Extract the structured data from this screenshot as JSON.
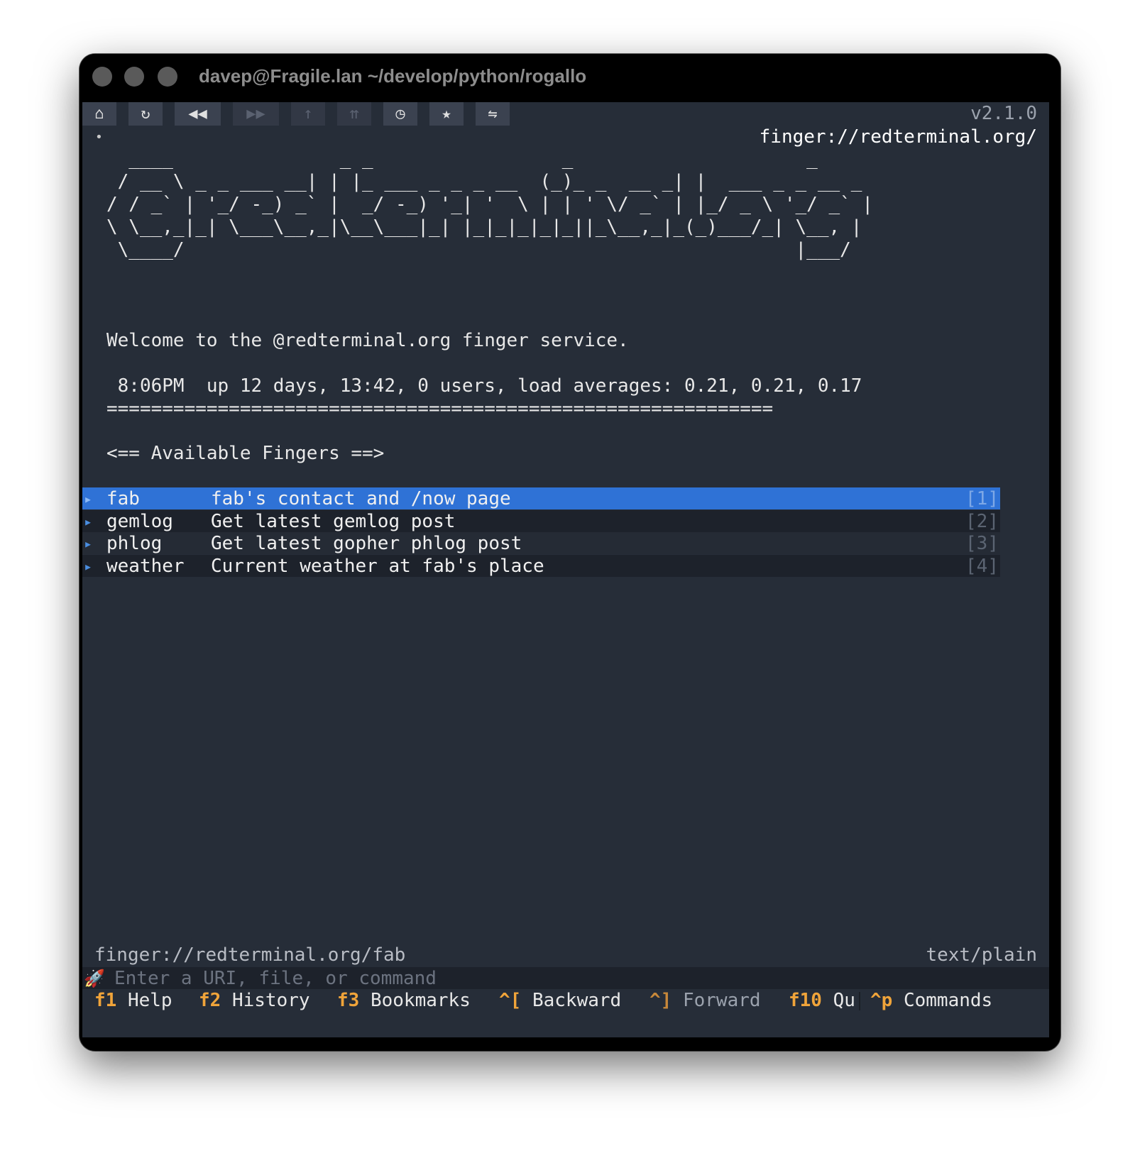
{
  "window": {
    "title": "davep@Fragile.lan ~/develop/python/rogallo"
  },
  "toolbar": {
    "buttons": [
      {
        "icon": "home-icon",
        "glyph": "⌂",
        "enabled": true
      },
      {
        "icon": "reload-icon",
        "glyph": "↻",
        "enabled": true
      },
      {
        "icon": "back-icon",
        "glyph": "◀◀",
        "enabled": true
      },
      {
        "icon": "forward-icon",
        "glyph": "▶▶",
        "enabled": false
      },
      {
        "icon": "up-icon",
        "glyph": "↑",
        "enabled": false
      },
      {
        "icon": "root-icon",
        "glyph": "⇈",
        "enabled": false
      },
      {
        "icon": "history-icon",
        "glyph": "◷",
        "enabled": true
      },
      {
        "icon": "bookmark-icon",
        "glyph": "★",
        "enabled": true
      },
      {
        "icon": "swap-icon",
        "glyph": "⇋",
        "enabled": true
      }
    ],
    "version": "v2.1.0"
  },
  "location": {
    "dot": "•",
    "url": "finger://redterminal.org/"
  },
  "content": {
    "ascii_banner": "  ____               _ _                 _                     _\n / __ \\ _ _ ___ __| | |_ ___ _ _ _ __  (_)_ _  __ _| |  ___ _ _ __ _\n/ / _` | '_/ -_) _` |  _/ -_) '_| '  \\ | | ' \\/ _` | |_/ _ \\ '_/ _` |\n\\ \\__,_|_| \\___\\__,_|\\__\\___|_| |_|_|_|_|_||_\\__,_|_(_)___/_| \\__, |\n \\____/                                                       |___/",
    "welcome": "Welcome to the @redterminal.org finger service.",
    "uptime": " 8:06PM  up 12 days, 13:42, 0 users, load averages: 0.21, 0.21, 0.17",
    "separator": "============================================================",
    "section_heading": "<== Available Fingers ==>"
  },
  "items": [
    {
      "flag": "▸",
      "name": "fab",
      "description": "fab's contact and /now page",
      "number": "[1]",
      "selected": true
    },
    {
      "flag": "▸",
      "name": "gemlog",
      "description": "Get latest gemlog post",
      "number": "[2]",
      "selected": false
    },
    {
      "flag": "▸",
      "name": "phlog",
      "description": "Get latest gopher phlog post",
      "number": "[3]",
      "selected": false
    },
    {
      "flag": "▸",
      "name": "weather",
      "description": "Current weather at fab's place",
      "number": "[4]",
      "selected": false
    }
  ],
  "status": {
    "url": "finger://redterminal.org/fab",
    "mime": "text/plain"
  },
  "input": {
    "icon": "rocket-icon",
    "placeholder": "Enter a URI, file, or command",
    "value": ""
  },
  "footer": {
    "keys": [
      {
        "key": "f1",
        "label": "Help"
      },
      {
        "key": "f2",
        "label": "History"
      },
      {
        "key": "f3",
        "label": "Bookmarks"
      },
      {
        "key": "^[",
        "label": "Backward"
      },
      {
        "key": "^]",
        "label": "Forward"
      },
      {
        "key": "f10",
        "label": "Qu"
      },
      {
        "key": "^p",
        "label": "Commands"
      }
    ]
  },
  "colors": {
    "background": "#262d38",
    "selection": "#2f72d6",
    "accent_key": "#f0a43a",
    "link_flag": "#4a8ee0"
  }
}
